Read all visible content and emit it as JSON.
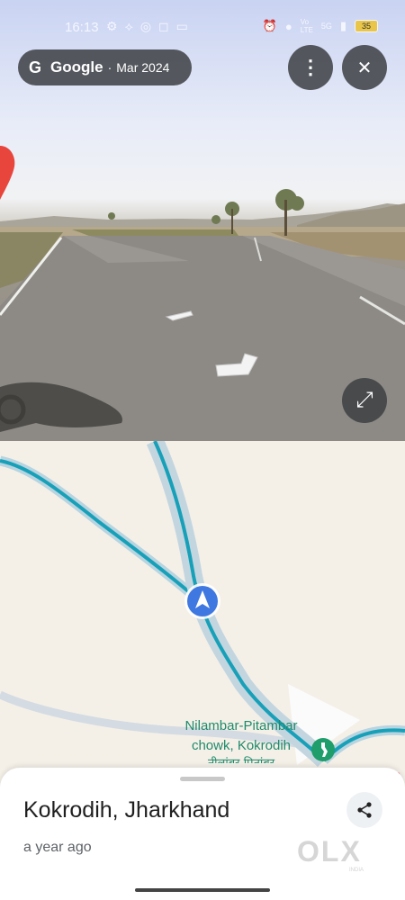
{
  "status_bar": {
    "time": "16:13",
    "left_icons": [
      "settings-icon",
      "share-network-icon",
      "whatsapp-icon",
      "instagram-icon",
      "app-icon"
    ],
    "right_icons": [
      "alarm-icon",
      "location-icon",
      "volte-icon",
      "signal-icon"
    ],
    "network": "5G",
    "battery": "35"
  },
  "street_view": {
    "chip": {
      "logo": "G",
      "brand": "Google",
      "separator": "·",
      "date": "Mar 2024"
    },
    "buttons": {
      "more": "⋮",
      "close": "✕",
      "expand": "⤢"
    }
  },
  "map": {
    "place_label_line1": "Nilambar-Pitambar",
    "place_label_line2": "chowk, Kokrodih",
    "place_label_line3": "नीलांबर-पितांबर"
  },
  "sheet": {
    "title": "Kokrodih, Jharkhand",
    "subtitle": "a year ago",
    "watermark": "OLX",
    "watermark_small": "INDIA"
  }
}
